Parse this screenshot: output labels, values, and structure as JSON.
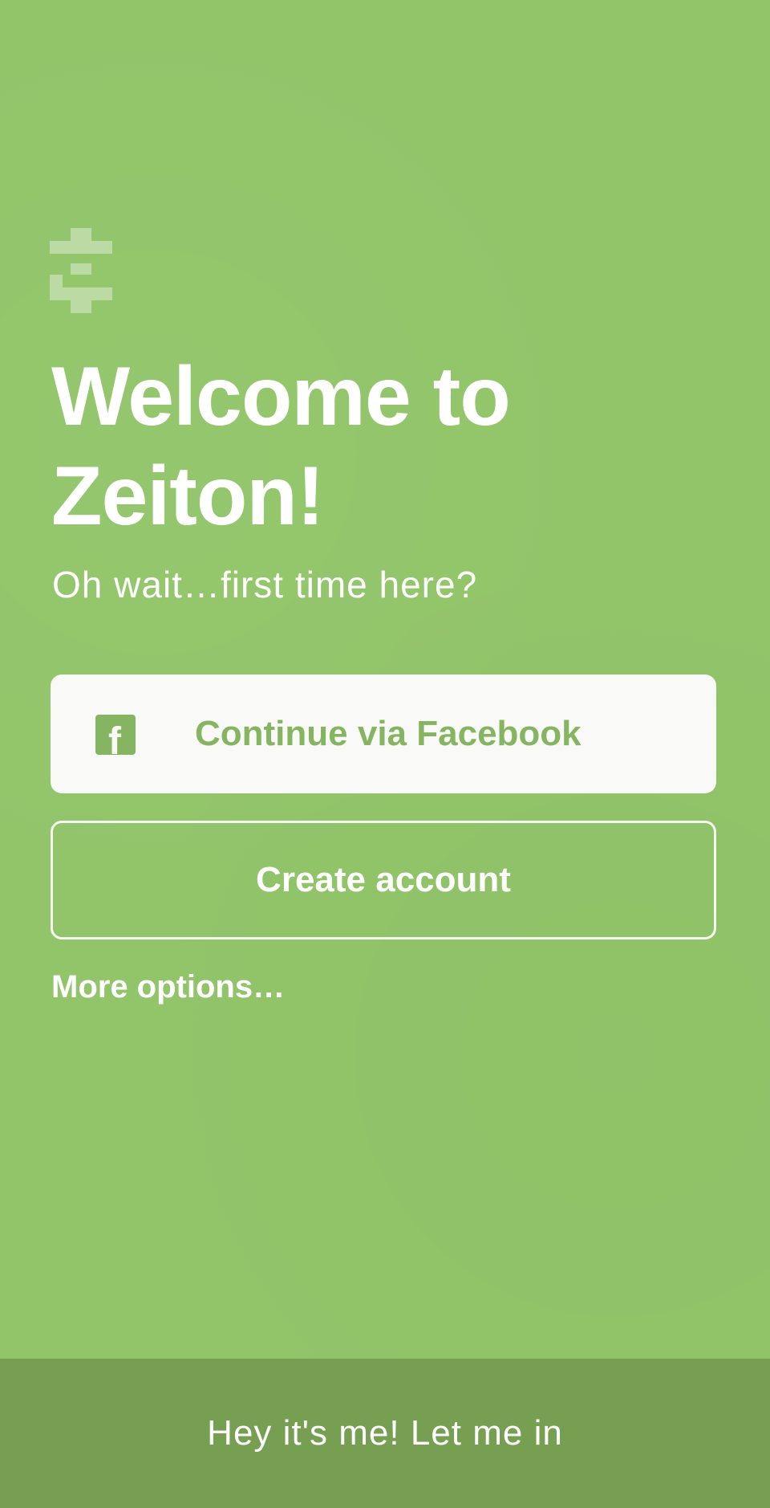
{
  "colors": {
    "background": "#92c56a",
    "accent": "#86b561",
    "footer": "#769f52",
    "text": "#ffffff",
    "button_background": "#f9f9f7"
  },
  "icons": {
    "logo": "zeiton-logo-icon",
    "facebook": "facebook-icon"
  },
  "welcome": {
    "title_line1": "Welcome to",
    "title_line2": "Zeiton!",
    "subtitle": "Oh wait…first time here?"
  },
  "actions": {
    "facebook_label": "Continue via Facebook",
    "create_account_label": "Create account",
    "more_options_label": "More options…"
  },
  "footer": {
    "login_label": "Hey it's me! Let me in"
  }
}
